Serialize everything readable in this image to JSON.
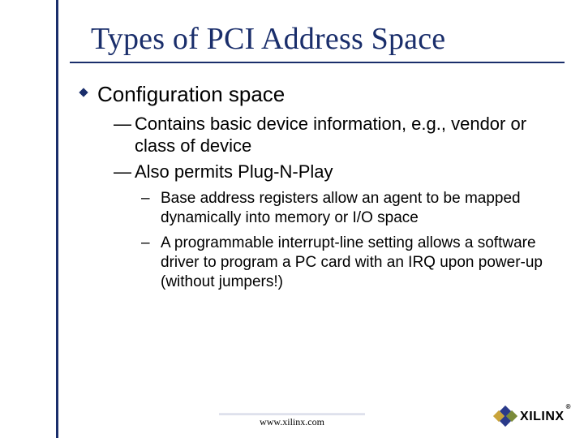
{
  "title": "Types of PCI Address Space",
  "bullets": {
    "lvl1": "Configuration space",
    "lvl2": [
      "Contains basic device information, e.g., vendor or class of device",
      "Also permits Plug-N-Play"
    ],
    "lvl3": [
      "Base address registers allow an agent to be mapped dynamically into memory or I/O space",
      "A programmable interrupt-line setting allows a software driver to program a PC card with an IRQ upon power-up (without jumpers!)"
    ]
  },
  "footer": {
    "url": "www.xilinx.com",
    "logo_text": "XILINX",
    "reg": "®"
  },
  "colors": {
    "accent": "#1a2e6b"
  }
}
